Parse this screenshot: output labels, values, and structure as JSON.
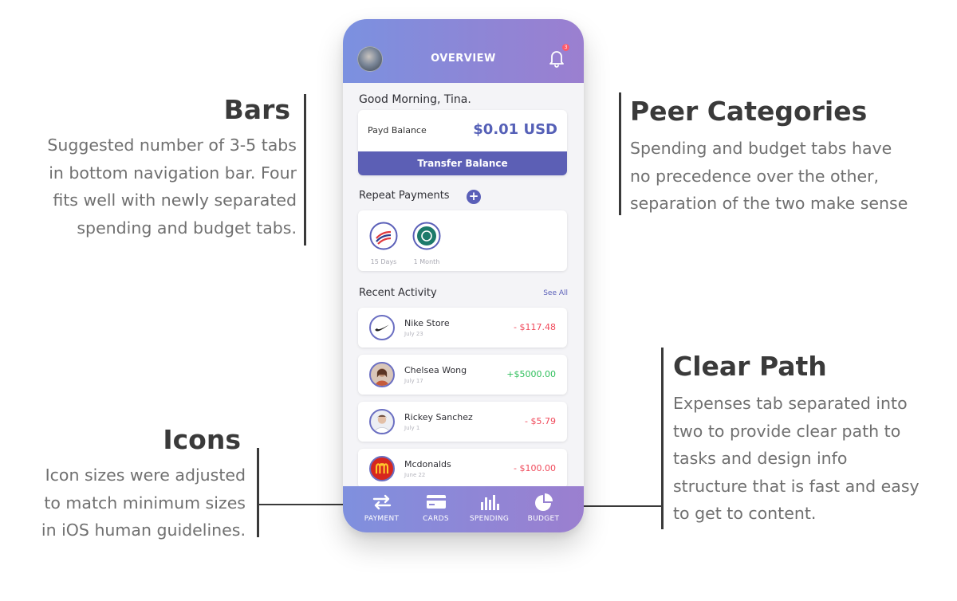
{
  "annotations": {
    "bars": {
      "title": "Bars",
      "lines": [
        "Suggested number of 3-5 tabs",
        "in bottom navigation bar. Four",
        "fits well with newly separated",
        "spending and budget tabs."
      ]
    },
    "peer": {
      "title": "Peer Categories",
      "lines": [
        "Spending and budget tabs have",
        "no precedence over the other,",
        "separation of the two make sense"
      ]
    },
    "clear": {
      "title": "Clear Path",
      "lines": [
        "Expenses tab separated into",
        "two to provide clear path to",
        "tasks and design info",
        "structure that is fast and easy",
        "to get to content."
      ]
    },
    "icons": {
      "title": "Icons",
      "lines": [
        "Icon sizes were adjusted",
        "to match minimum sizes",
        "in iOS human guidelines."
      ]
    }
  },
  "phone": {
    "header": {
      "title": "OVERVIEW",
      "notification_count": "3"
    },
    "greeting": "Good Morning, Tina.",
    "balance": {
      "label": "Payd Balance",
      "value": "$0.01 USD",
      "button": "Transfer Balance"
    },
    "repeat_payments": {
      "title": "Repeat Payments",
      "add_symbol": "+",
      "items": [
        {
          "label": "15 Days",
          "icon": "bank-of-america-logo"
        },
        {
          "label": "1 Month",
          "icon": "tlc-logo"
        }
      ]
    },
    "recent_activity": {
      "title": "Recent Activity",
      "see_all": "See All",
      "items": [
        {
          "name": "Nike Store",
          "date": "July 23",
          "amount": "- $117.48",
          "icon": "nike-logo"
        },
        {
          "name": "Chelsea Wong",
          "date": "July 17",
          "amount": "+$5000.00",
          "icon": "person-avatar"
        },
        {
          "name": "Rickey Sanchez",
          "date": "July 1",
          "amount": "- $5.79",
          "icon": "person-avatar"
        },
        {
          "name": "Mcdonalds",
          "date": "June 22",
          "amount": "- $100.00",
          "icon": "mcdonalds-logo"
        }
      ]
    },
    "tabs": [
      {
        "label": "PAYMENT",
        "icon": "transfer-arrows-icon"
      },
      {
        "label": "CARDS",
        "icon": "card-icon"
      },
      {
        "label": "SPENDING",
        "icon": "bar-chart-icon"
      },
      {
        "label": "BUDGET",
        "icon": "pie-chart-icon"
      }
    ]
  },
  "colors": {
    "accent": "#5c5fb5",
    "negative": "#f04a5b",
    "positive": "#2fbf5c"
  }
}
